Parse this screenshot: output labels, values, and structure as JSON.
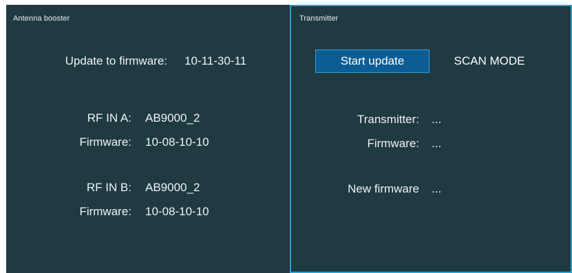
{
  "antenna_booster": {
    "title": "Antenna booster",
    "update_label": "Update to firmware:",
    "update_value": "10-11-30-11",
    "rf_a": {
      "label": "RF IN A:",
      "value": "AB9000_2",
      "firmware_label": "Firmware:",
      "firmware_value": "10-08-10-10"
    },
    "rf_b": {
      "label": "RF IN B:",
      "value": "AB9000_2",
      "firmware_label": "Firmware:",
      "firmware_value": "10-08-10-10"
    }
  },
  "transmitter": {
    "title": "Transmitter",
    "start_update_label": "Start update",
    "scan_mode_label": "SCAN MODE",
    "transmitter_label": "Transmitter:",
    "transmitter_value": "...",
    "firmware_label": "Firmware:",
    "firmware_value": "...",
    "new_firmware_label": "New firmware",
    "new_firmware_value": "..."
  },
  "colors": {
    "background": "#203a42",
    "selected_border": "#2aa3cf",
    "button_fill": "#0d5d94",
    "text": "#eef3f5"
  }
}
